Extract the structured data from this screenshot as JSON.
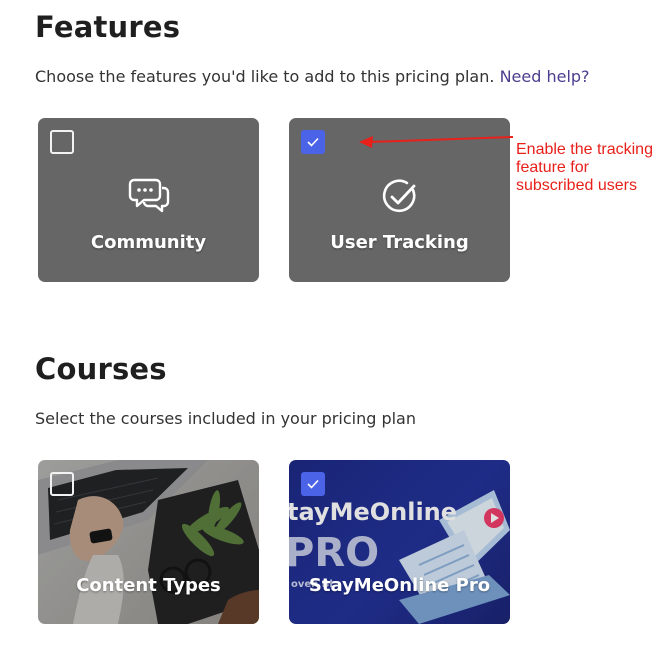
{
  "features": {
    "title": "Features",
    "description": "Choose the features you'd like to add to this pricing plan.",
    "help_link": "Need help?",
    "cards": [
      {
        "label": "Community",
        "icon": "chat-bubbles-icon",
        "checked": false
      },
      {
        "label": "User Tracking",
        "icon": "check-circle-icon",
        "checked": true
      }
    ]
  },
  "annotation": {
    "text": "Enable the tracking feature for subscribed users",
    "color": "#e8201a"
  },
  "courses": {
    "title": "Courses",
    "description": "Select the courses included in your pricing plan",
    "cards": [
      {
        "label": "Content Types",
        "image": "desk-laptop-plant-photo",
        "checked": false
      },
      {
        "label": "StayMeOnline Pro",
        "image": "staymeonline-pro-banner",
        "checked": true,
        "banner_line1": "tayMeOnline",
        "banner_line2": "PRO",
        "banner_small": "oven Bl"
      }
    ]
  },
  "colors": {
    "card_bg": "#666666",
    "checkbox_checked": "#4a63e7",
    "link": "#4d3d8f"
  }
}
